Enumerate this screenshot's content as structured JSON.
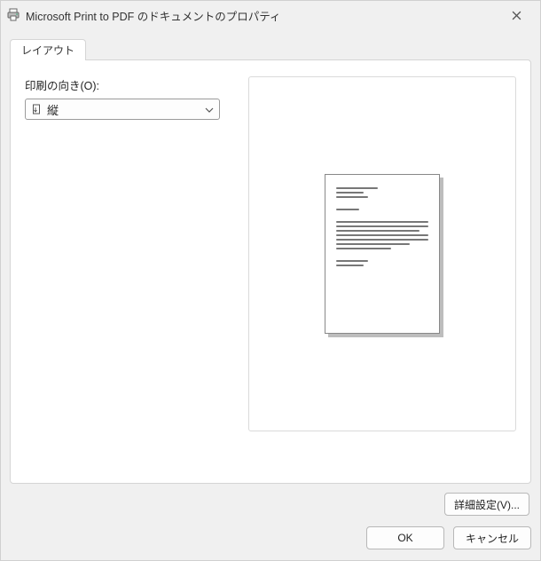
{
  "window": {
    "title": "Microsoft Print to PDF のドキュメントのプロパティ"
  },
  "tabs": {
    "layout_label": "レイアウト"
  },
  "orientation": {
    "label": "印刷の向き(O):",
    "value": "縦"
  },
  "buttons": {
    "advanced": "詳細設定(V)...",
    "ok": "OK",
    "cancel": "キャンセル"
  }
}
